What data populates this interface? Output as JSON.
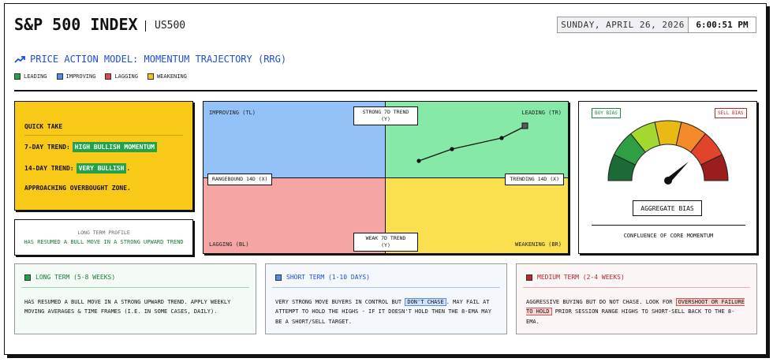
{
  "header": {
    "title": "S&P 500 INDEX",
    "ticker": "US500",
    "date": "SUNDAY, APRIL 26, 2026",
    "time": "6:00:51 PM"
  },
  "model": {
    "icon": "trend-up-icon",
    "title": "PRICE ACTION MODEL: MOMENTUM TRAJECTORY (RRG)"
  },
  "legend": [
    {
      "label": "LEADING",
      "color": "#22a34a"
    },
    {
      "label": "IMPROVING",
      "color": "#4f8ee6"
    },
    {
      "label": "LAGGING",
      "color": "#e0474c"
    },
    {
      "label": "WEAKENING",
      "color": "#f2c21a"
    }
  ],
  "quick_take": {
    "heading": "QUICK TAKE",
    "trend7_label": "7-DAY TREND:",
    "trend7_value": "HIGH BULLISH MOMENTUM",
    "trend14_label": "14-DAY TREND:",
    "trend14_value": "VERY BULLISH",
    "trend14_suffix": ".",
    "note": "APPROACHING OVERBOUGHT ZONE."
  },
  "long_term_profile": {
    "label": "LONG TERM PROFILE",
    "value": "HAS RESUMED A BULL MOVE IN A STRONG UPWARD TREND"
  },
  "quadrant": {
    "labels": {
      "improving": "IMPROVING (TL)",
      "leading": "LEADING (TR)",
      "lagging": "LAGGING (BL)",
      "weakening": "WEAKENING (BR)"
    },
    "axes": {
      "top_line1": "STRONG 7D TREND",
      "top_line2": "(Y)",
      "bottom_line1": "WEAK 7D TREND",
      "bottom_line2": "(Y)",
      "left": "RANGEBOUND 14D (X)",
      "right": "TRENDING 14D (X)"
    }
  },
  "gauge": {
    "buy_bias": "BUY BIAS",
    "sell_bias": "SELL BIAS",
    "button": "AGGREGATE BIAS",
    "caption": "CONFLUENCE OF CORE MOMENTUM",
    "segment_colors": [
      "#1c6b36",
      "#2f9e44",
      "#a3d92f",
      "#e9b914",
      "#f58a2b",
      "#e0452c",
      "#9b1d1d"
    ]
  },
  "cards": {
    "long": {
      "title": "LONG TERM (5-8 WEEKS)",
      "color": "#22a34a",
      "text": "HAS RESUMED A BULL MOVE IN A STRONG UPWARD TREND. APPLY WEEKLY MOVING AVERAGES & TIME FRAMES (I.E. IN SOME CASES, DAILY)."
    },
    "short": {
      "title": "SHORT TERM (1-10 DAYS)",
      "color": "#4f8ee6",
      "text_before": "VERY STRONG MOVE BUYERS IN CONTROL BUT ",
      "highlight": "DON'T CHASE",
      "text_after": ". MAY FAIL AT ATTEMPT TO HOLD THE HIGHS - IF IT DOESN'T HOLD THEN THE 8-EMA MAY BE A SHORT/SELL TARGET."
    },
    "medium": {
      "title": "MEDIUM TERM (2-4 WEEKS)",
      "color": "#c0262d",
      "text_before": "AGGRESSIVE BUYING BUT DO NOT CHASE. LOOK FOR ",
      "highlight": "OVERSHOOT OR FAILURE TO HOLD",
      "text_after": " PRIOR SESSION RANGE HIGHS TO SHORT-SELL BACK TO THE 8-EMA."
    }
  }
}
